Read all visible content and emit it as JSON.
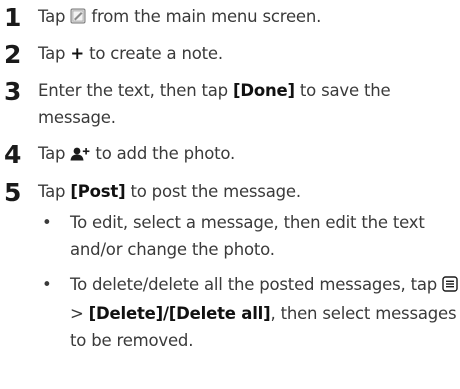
{
  "steps": [
    {
      "number": "1",
      "before_icon": "Tap ",
      "icon": "notes-app-icon",
      "after_icon": " from the main menu screen."
    },
    {
      "number": "2",
      "before": "Tap ",
      "symbol": "+",
      "after": " to create a note."
    },
    {
      "number": "3",
      "before": "Enter the text, then tap ",
      "button": "[Done]",
      "after": " to save the message."
    },
    {
      "number": "4",
      "before_icon": "Tap ",
      "icon": "add-photo-icon",
      "after_icon": " to add the photo."
    },
    {
      "number": "5",
      "before": "Tap ",
      "button": "[Post]",
      "after": " to post the message."
    }
  ],
  "bullets": [
    {
      "marker": "•",
      "text": "To edit, select a message, then edit the text and/or change the photo."
    },
    {
      "marker": "•",
      "before": "To delete/delete all the posted messages, tap ",
      "icon": "menu-icon",
      "middle": " > ",
      "button1": "[Delete]",
      "separator": "/",
      "button2": "[Delete all]",
      "after": ", then select messages to be removed."
    }
  ],
  "colors": {
    "text": "#3a3a3a",
    "emphasis": "#111111"
  }
}
